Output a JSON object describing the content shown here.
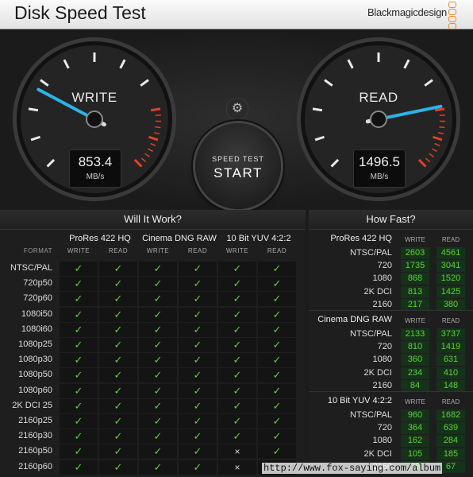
{
  "app": {
    "title": "Disk Speed Test",
    "brand": "Blackmagicdesign"
  },
  "write_gauge": {
    "label": "WRITE",
    "value": "853.4",
    "unit": "MB/s",
    "needle_fraction": 0.27
  },
  "read_gauge": {
    "label": "READ",
    "value": "1496.5",
    "unit": "MB/s",
    "needle_fraction": 0.79
  },
  "start_button": {
    "line1": "SPEED TEST",
    "line2": "START"
  },
  "settings": {
    "icon": "gear-icon",
    "glyph": "⚙"
  },
  "will_it_work": {
    "title": "Will It Work?",
    "format_header": "FORMAT",
    "groups": [
      "ProRes 422 HQ",
      "Cinema DNG RAW",
      "10 Bit YUV 4:2:2"
    ],
    "col_write": "WRITE",
    "col_read": "READ",
    "rows": [
      {
        "label": "NTSC/PAL",
        "cells": [
          "✓",
          "✓",
          "✓",
          "✓",
          "✓",
          "✓"
        ]
      },
      {
        "label": "720p50",
        "cells": [
          "✓",
          "✓",
          "✓",
          "✓",
          "✓",
          "✓"
        ]
      },
      {
        "label": "720p60",
        "cells": [
          "✓",
          "✓",
          "✓",
          "✓",
          "✓",
          "✓"
        ]
      },
      {
        "label": "1080i50",
        "cells": [
          "✓",
          "✓",
          "✓",
          "✓",
          "✓",
          "✓"
        ]
      },
      {
        "label": "1080i60",
        "cells": [
          "✓",
          "✓",
          "✓",
          "✓",
          "✓",
          "✓"
        ]
      },
      {
        "label": "1080p25",
        "cells": [
          "✓",
          "✓",
          "✓",
          "✓",
          "✓",
          "✓"
        ]
      },
      {
        "label": "1080p30",
        "cells": [
          "✓",
          "✓",
          "✓",
          "✓",
          "✓",
          "✓"
        ]
      },
      {
        "label": "1080p50",
        "cells": [
          "✓",
          "✓",
          "✓",
          "✓",
          "✓",
          "✓"
        ]
      },
      {
        "label": "1080p60",
        "cells": [
          "✓",
          "✓",
          "✓",
          "✓",
          "✓",
          "✓"
        ]
      },
      {
        "label": "2K DCI 25",
        "cells": [
          "✓",
          "✓",
          "✓",
          "✓",
          "✓",
          "✓"
        ]
      },
      {
        "label": "2160p25",
        "cells": [
          "✓",
          "✓",
          "✓",
          "✓",
          "✓",
          "✓"
        ]
      },
      {
        "label": "2160p30",
        "cells": [
          "✓",
          "✓",
          "✓",
          "✓",
          "✓",
          "✓"
        ]
      },
      {
        "label": "2160p50",
        "cells": [
          "✓",
          "✓",
          "✓",
          "✓",
          "×",
          "✓"
        ]
      },
      {
        "label": "2160p60",
        "cells": [
          "✓",
          "✓",
          "✓",
          "✓",
          "×",
          "✓"
        ]
      }
    ]
  },
  "how_fast": {
    "title": "How Fast?",
    "col_write": "WRITE",
    "col_read": "READ",
    "sections": [
      {
        "title": "ProRes 422 HQ",
        "rows": [
          {
            "label": "NTSC/PAL",
            "write": "2603",
            "read": "4561"
          },
          {
            "label": "720",
            "write": "1735",
            "read": "3041"
          },
          {
            "label": "1080",
            "write": "868",
            "read": "1520"
          },
          {
            "label": "2K DCI",
            "write": "813",
            "read": "1425"
          },
          {
            "label": "2160",
            "write": "217",
            "read": "380"
          }
        ]
      },
      {
        "title": "Cinema DNG RAW",
        "rows": [
          {
            "label": "NTSC/PAL",
            "write": "2133",
            "read": "3737"
          },
          {
            "label": "720",
            "write": "810",
            "read": "1419"
          },
          {
            "label": "1080",
            "write": "360",
            "read": "631"
          },
          {
            "label": "2K DCI",
            "write": "234",
            "read": "410"
          },
          {
            "label": "2160",
            "write": "84",
            "read": "148"
          }
        ]
      },
      {
        "title": "10 Bit YUV 4:2:2",
        "rows": [
          {
            "label": "NTSC/PAL",
            "write": "960",
            "read": "1682"
          },
          {
            "label": "720",
            "write": "364",
            "read": "639"
          },
          {
            "label": "1080",
            "write": "162",
            "read": "284"
          },
          {
            "label": "2K DCI",
            "write": "105",
            "read": "185"
          },
          {
            "label": "2160",
            "write": "38",
            "read": "67"
          }
        ]
      }
    ]
  },
  "watermark": "http://www.fox-saying.com/album",
  "colors": {
    "accent": "#2ab4e8",
    "ok": "#5ad13a",
    "warn": "#e0402a"
  }
}
